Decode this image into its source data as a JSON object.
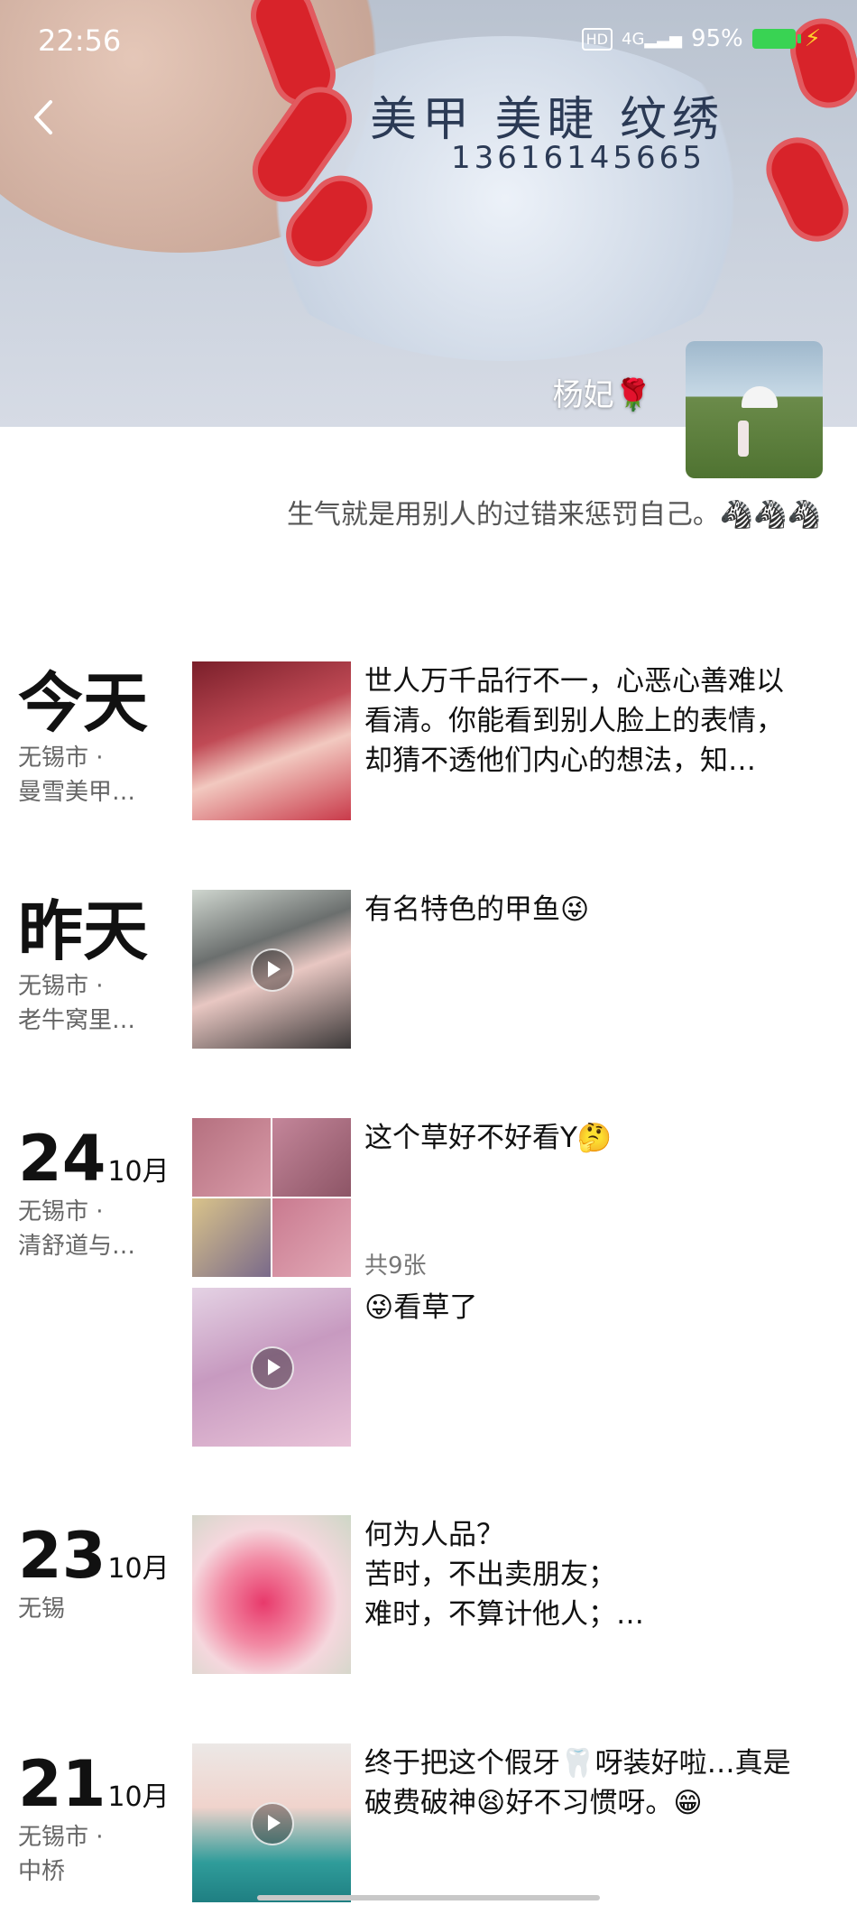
{
  "status_bar": {
    "time": "22:56",
    "hd": "HD",
    "network": "4G",
    "battery_text": "95%",
    "battery_level": 0.95,
    "battery_color": "#39d353"
  },
  "nav": {
    "back_icon": "chevron-left-icon"
  },
  "cover": {
    "line1": "美甲 美睫 纹绣",
    "line2": "13616145665"
  },
  "profile": {
    "nickname": "杨妃🌹",
    "signature": "生气就是用别人的过错来惩罚自己。🦓🦓🦓"
  },
  "feed": [
    {
      "date": "今天",
      "location_line1": "无锡市 ·",
      "location_line2": "曼雪美甲…",
      "text": "世人万千品行不一，心恶心善难以\n看清。你能看到别人脸上的表情，\n却猜不透他们内心的想法，知…",
      "media": "photo"
    },
    {
      "date": "昨天",
      "location_line1": "无锡市 ·",
      "location_line2": "老牛窝里…",
      "text": "有名特色的甲鱼😜",
      "media": "video"
    },
    {
      "day": "24",
      "month": "10月",
      "location_line1": "无锡市 ·",
      "location_line2": "清舒道与…",
      "posts": [
        {
          "text": "这个草好不好看Y🤔",
          "count_label": "共9张",
          "media": "grid"
        },
        {
          "text": "😜看草了",
          "media": "video"
        }
      ]
    },
    {
      "day": "23",
      "month": "10月",
      "location_line1": "无锡",
      "text": "何为人品？\n苦时，不出卖朋友；\n难时，不算计他人；…",
      "media": "photo"
    },
    {
      "day": "21",
      "month": "10月",
      "location_line1": "无锡市 ·",
      "location_line2": "中桥",
      "text": "终于把这个假牙🦷呀装好啦…真是\n破费破神😫好不习惯呀。😁",
      "media": "video"
    }
  ]
}
